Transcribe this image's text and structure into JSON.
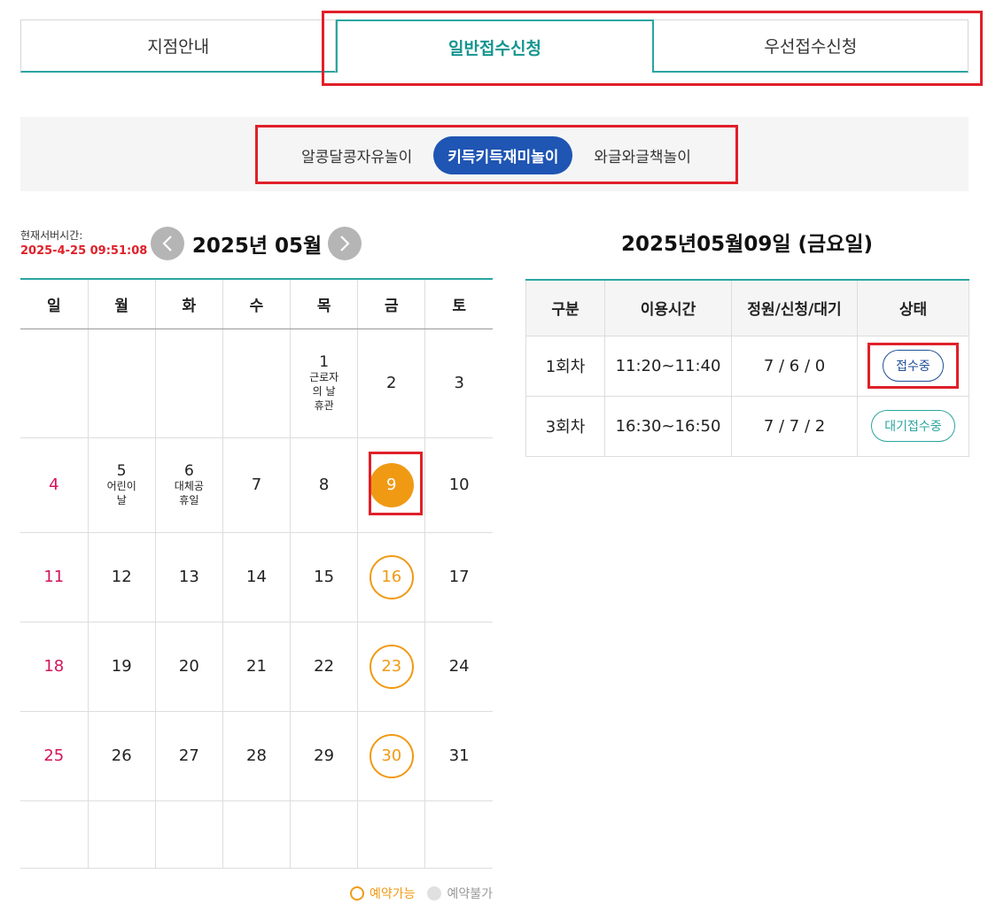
{
  "tabs": [
    "지점안내",
    "일반접수신청",
    "우선접수신청"
  ],
  "subtabs": [
    "알콩달콩자유놀이",
    "키득키득재미놀이",
    "와글와글책놀이"
  ],
  "server": {
    "label": "현재서버시간:",
    "time": "2025-4-25 09:51:08"
  },
  "calendar": {
    "month_title": "2025년 05월",
    "weekdays": [
      "일",
      "월",
      "화",
      "수",
      "목",
      "금",
      "토"
    ],
    "weeks": [
      [
        "",
        "",
        "",
        "",
        "1",
        "2",
        "3"
      ],
      [
        "4",
        "5",
        "6",
        "7",
        "8",
        "9",
        "10"
      ],
      [
        "11",
        "12",
        "13",
        "14",
        "15",
        "16",
        "17"
      ],
      [
        "18",
        "19",
        "20",
        "21",
        "22",
        "23",
        "24"
      ],
      [
        "25",
        "26",
        "27",
        "28",
        "29",
        "30",
        "31"
      ]
    ],
    "holiday_notes": {
      "h1": [
        "근로자",
        "의 날",
        "휴관"
      ],
      "h5": [
        "어린이",
        "날"
      ],
      "h6": [
        "대체공",
        "휴일"
      ]
    },
    "selected_day": "9",
    "available_days": [
      "16",
      "23",
      "30"
    ]
  },
  "legend": {
    "available": "예약가능",
    "unavailable": "예약불가"
  },
  "schedule": {
    "date_title": "2025년05월09일 (금요일)",
    "headers": [
      "구분",
      "이용시간",
      "정원/신청/대기",
      "상태"
    ],
    "rows": [
      {
        "session": "1회차",
        "time": "11:20~11:40",
        "counts": "7 / 6 / 0",
        "status": "접수중"
      },
      {
        "session": "3회차",
        "time": "16:30~16:50",
        "counts": "7 / 7 / 2",
        "status": "대기접수중"
      }
    ]
  },
  "colors": {
    "teal": "#2aa5a0",
    "blue": "#1f55b3",
    "orange": "#f09a14",
    "holiday": "#d4145a",
    "highlight": "#e0202a"
  }
}
